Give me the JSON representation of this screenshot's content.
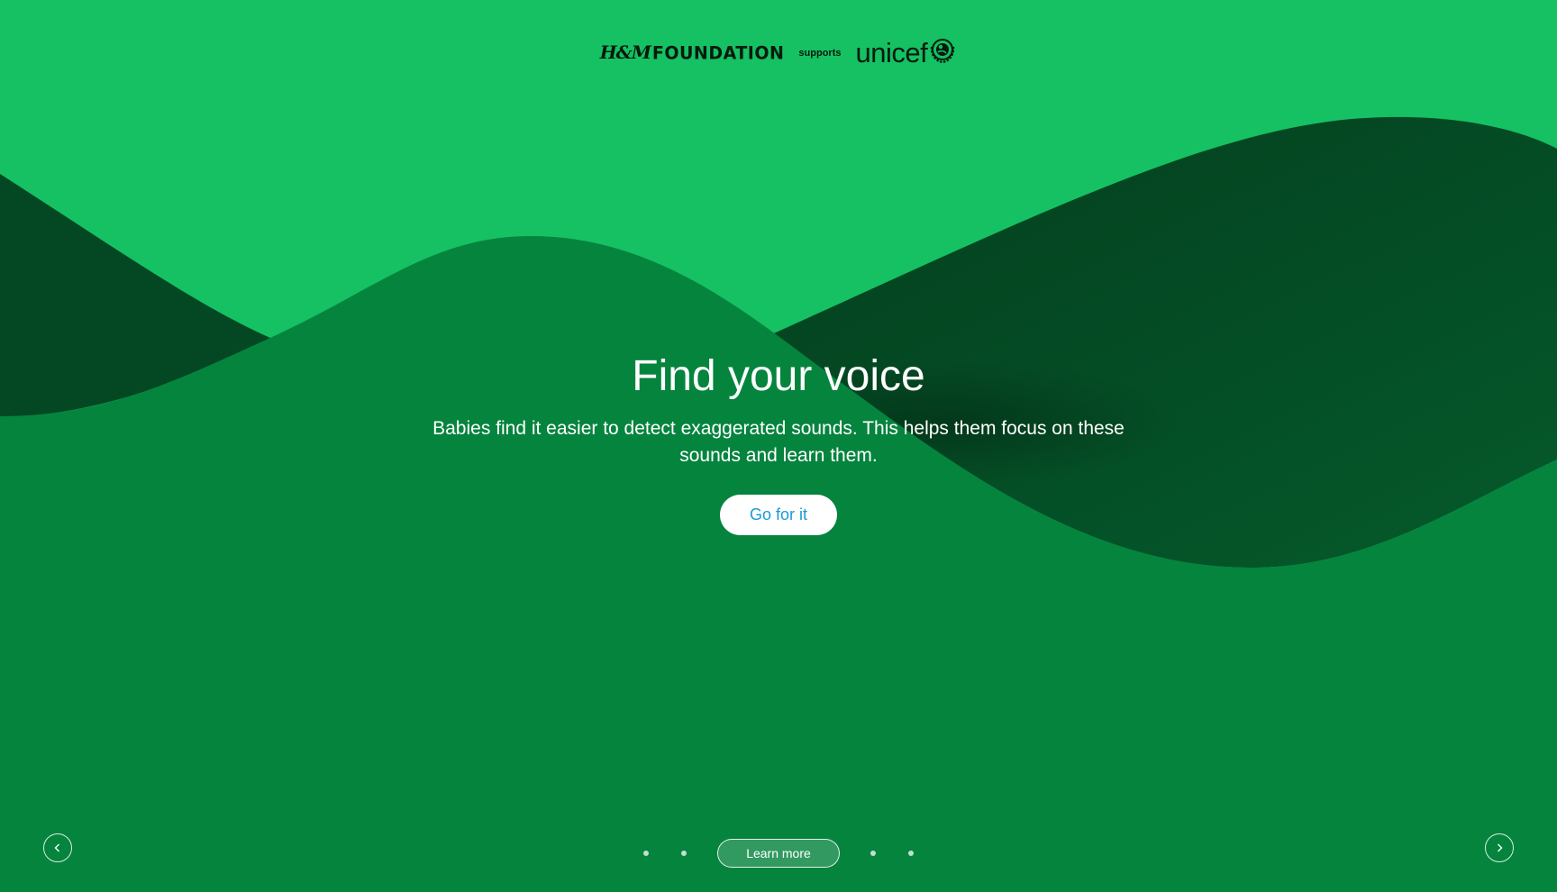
{
  "header": {
    "hm_mark": "H&M",
    "hm_word": "FOUNDATION",
    "supports": "supports",
    "unicef": "unicef"
  },
  "hero": {
    "title": "Find your voice",
    "text": "Babies find it easier to detect exaggerated sounds. This helps them focus on these sounds and learn them.",
    "cta_label": "Go for it"
  },
  "pager": {
    "learn_more_label": "Learn more",
    "dots_before": 2,
    "dots_after": 2
  },
  "icons": {
    "prev": "chevron-left-icon",
    "next": "chevron-right-icon",
    "emblem": "unicef-emblem-icon"
  },
  "colors": {
    "light_green": "#15c163",
    "mid_green": "#05843e",
    "dark_green": "#044723",
    "cta_text": "#1a9ad6"
  }
}
